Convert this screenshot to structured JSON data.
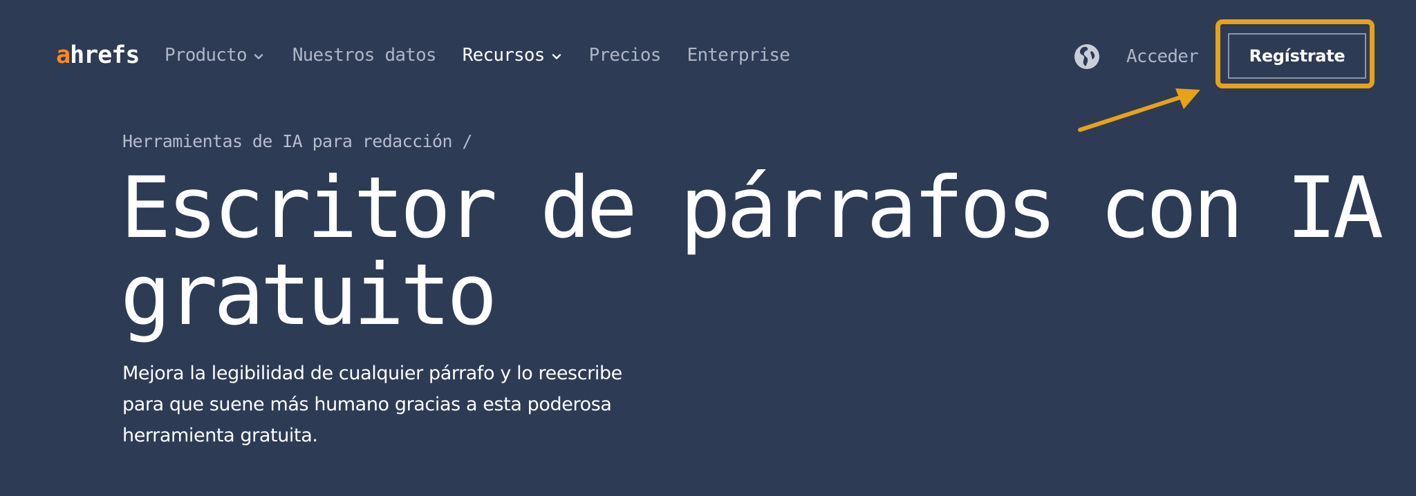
{
  "brand": {
    "logo_a": "a",
    "logo_rest": "hrefs",
    "accent_color": "#ff8a1f"
  },
  "nav": {
    "items": [
      {
        "label": "Producto",
        "has_dropdown": true
      },
      {
        "label": "Nuestros datos",
        "has_dropdown": false
      },
      {
        "label": "Recursos",
        "has_dropdown": true,
        "active": true
      },
      {
        "label": "Precios",
        "has_dropdown": false
      },
      {
        "label": "Enterprise",
        "has_dropdown": false
      }
    ],
    "language_icon": "globe-icon",
    "login_label": "Acceder",
    "signup_label": "Regístrate"
  },
  "annotation": {
    "highlight_color": "#e8a21a",
    "target": "signup-button"
  },
  "main": {
    "breadcrumb": "Herramientas de IA para redacción /",
    "title_lines": [
      "Escritor de párrafos con IA",
      "gratuito"
    ],
    "subtitle_lines": [
      "Mejora la legibilidad de cualquier párrafo y lo reescribe",
      "para que suene más humano gracias a esta poderosa",
      "herramienta gratuita."
    ]
  },
  "colors": {
    "background": "#2e3b55",
    "nav_text": "#aeb6c6",
    "text": "#ffffff"
  }
}
